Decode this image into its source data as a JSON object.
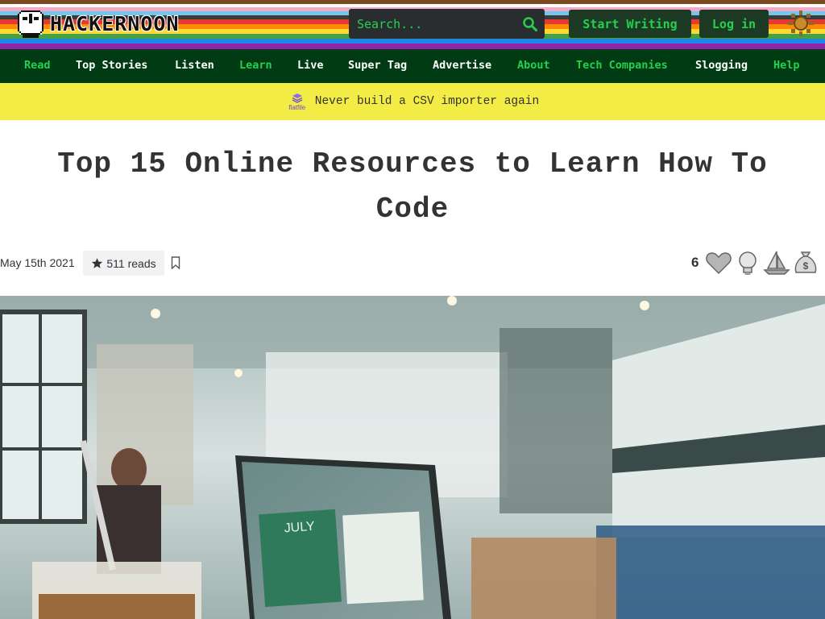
{
  "header": {
    "logo_text": "HACKERNOON",
    "search_placeholder": "Search...",
    "start_writing": "Start Writing",
    "login": "Log in",
    "theme_icon": "sun-icon"
  },
  "nav": {
    "items": [
      {
        "label": "Read",
        "color": "#24d14f"
      },
      {
        "label": "Top Stories",
        "color": "#ffffff"
      },
      {
        "label": "Listen",
        "color": "#ffffff"
      },
      {
        "label": "Learn",
        "color": "#24d14f"
      },
      {
        "label": "Live",
        "color": "#ffffff"
      },
      {
        "label": "Super Tag",
        "color": "#ffffff"
      },
      {
        "label": "Advertise",
        "color": "#ffffff"
      },
      {
        "label": "About",
        "color": "#24d14f"
      },
      {
        "label": "Tech Companies",
        "color": "#24d14f"
      },
      {
        "label": "Slogging",
        "color": "#ffffff"
      },
      {
        "label": "Help",
        "color": "#24d14f"
      }
    ]
  },
  "banner": {
    "logo_label": "flatfile",
    "text": "Never build a CSV importer again"
  },
  "article": {
    "title": "Top 15 Online Resources to Learn How To Code",
    "date": "May 15th 2021",
    "reads": "511 reads",
    "reaction_count": "6",
    "reactions": [
      "heart-icon",
      "lightbulb-icon",
      "boat-icon",
      "money-bag-icon"
    ],
    "hero_month": "JULY"
  },
  "colors": {
    "nav_bg": "#003b14",
    "accent_green": "#24d14f",
    "banner_bg": "#f2ec44"
  }
}
